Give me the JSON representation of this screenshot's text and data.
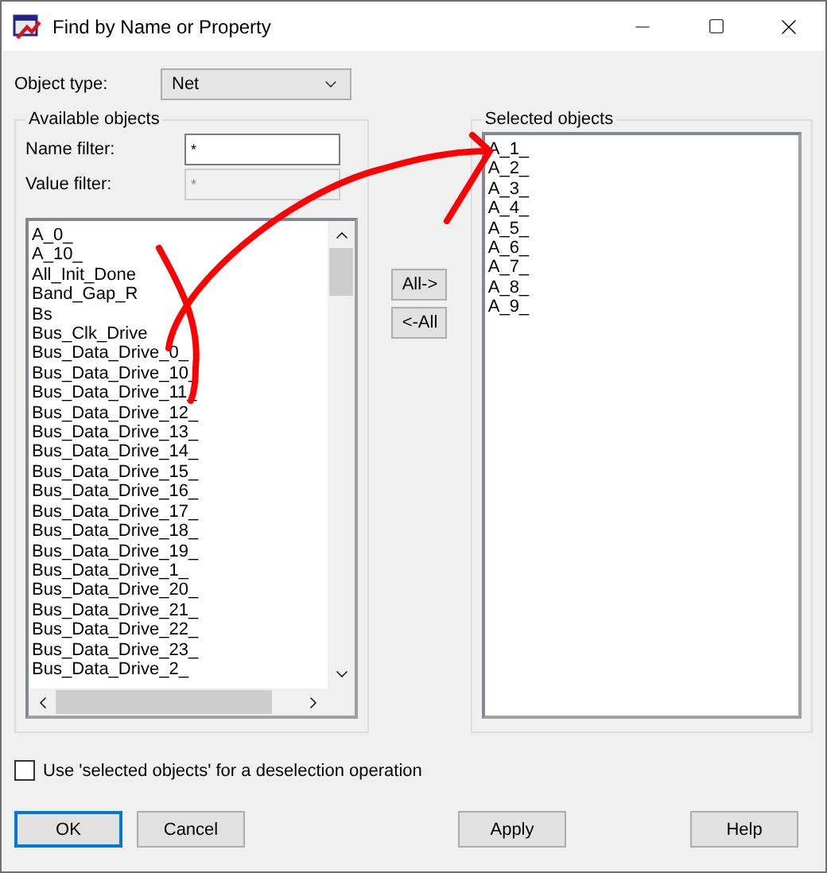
{
  "window": {
    "title": "Find by Name or Property"
  },
  "object_type": {
    "label": "Object type:",
    "value": "Net"
  },
  "available": {
    "title": "Available objects",
    "name_filter": {
      "label": "Name filter:",
      "value": "*",
      "disabled": false
    },
    "value_filter": {
      "label": "Value filter:",
      "value": "*",
      "disabled": true
    },
    "items": [
      "A_0_",
      "A_10_",
      "All_Init_Done",
      "Band_Gap_R",
      "Bs",
      "Bus_Clk_Drive",
      "Bus_Data_Drive_0_",
      "Bus_Data_Drive_10_",
      "Bus_Data_Drive_11_",
      "Bus_Data_Drive_12_",
      "Bus_Data_Drive_13_",
      "Bus_Data_Drive_14_",
      "Bus_Data_Drive_15_",
      "Bus_Data_Drive_16_",
      "Bus_Data_Drive_17_",
      "Bus_Data_Drive_18_",
      "Bus_Data_Drive_19_",
      "Bus_Data_Drive_1_",
      "Bus_Data_Drive_20_",
      "Bus_Data_Drive_21_",
      "Bus_Data_Drive_22_",
      "Bus_Data_Drive_23_",
      "Bus_Data_Drive_2_"
    ]
  },
  "transfer_buttons": [
    "All->",
    "<-All"
  ],
  "selected": {
    "title": "Selected objects",
    "items": [
      "A_1_",
      "A_2_",
      "A_3_",
      "A_4_",
      "A_5_",
      "A_6_",
      "A_7_",
      "A_8_",
      "A_9_"
    ]
  },
  "deselect_option": {
    "label": "Use 'selected objects' for a deselection operation",
    "checked": false
  },
  "buttons": [
    {
      "label": "OK",
      "default": true
    },
    {
      "label": "Cancel",
      "default": false
    },
    {
      "label": "Apply",
      "default": false
    },
    {
      "label": "Help",
      "default": false
    }
  ]
}
